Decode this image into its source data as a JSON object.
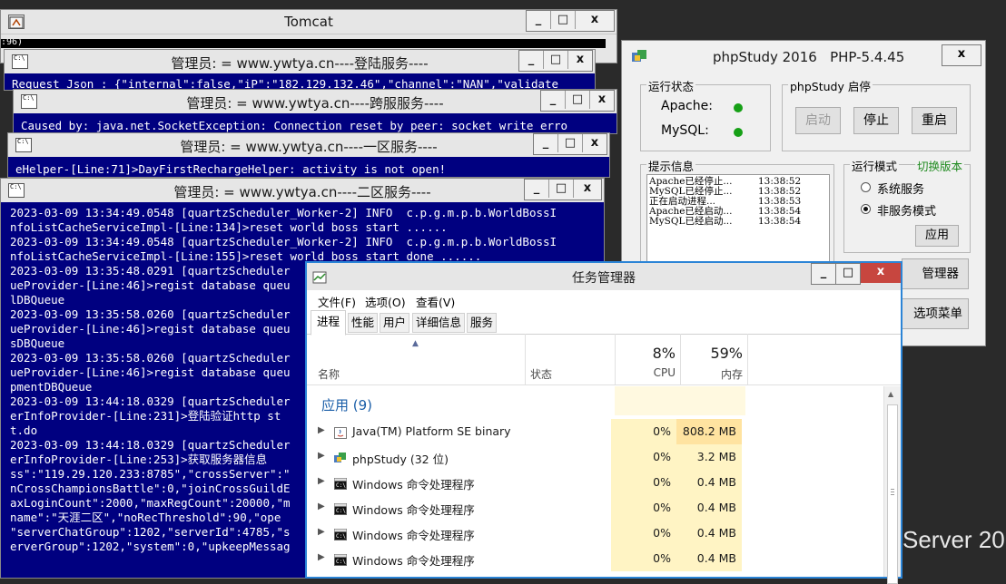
{
  "tomcat": {
    "title": "Tomcat",
    "line": ":96)"
  },
  "window_controls": {
    "minimize": "_",
    "maximize": "□",
    "close": "x"
  },
  "cmd_login": {
    "title": "管理员: = www.ywtya.cn----登陆服务----",
    "line": "Request Json : {\"internal\":false,\"iP\":\"182.129.132.46\",\"channel\":\"NAN\",\"validate"
  },
  "cmd_cross": {
    "title": "管理员: = www.ywtya.cn----跨服服务----",
    "line": "Caused by: java.net.SocketException: Connection reset by peer: socket write erro"
  },
  "cmd_zone1": {
    "title": "管理员: = www.ywtya.cn----一区服务----",
    "line": "eHelper-[Line:71]>DayFirstRechargeHelper: activity is not open!"
  },
  "cmd_zone2": {
    "title": "管理员: = www.ywtya.cn----二区服务----",
    "lines": [
      "2023-03-09 13:34:49.0548 [quartzScheduler_Worker-2] INFO  c.p.g.m.p.b.WorldBossI",
      "nfoListCacheServiceImpl-[Line:134]>reset world boss start ......",
      "2023-03-09 13:34:49.0548 [quartzScheduler_Worker-2] INFO  c.p.g.m.p.b.WorldBossI",
      "nfoListCacheServiceImpl-[Line:155]>reset world boss start done ......",
      "2023-03-09 13:35:48.0291 [quartzScheduler",
      "ueProvider-[Line:46]>regist database queu",
      "lDBQueue",
      "2023-03-09 13:35:58.0260 [quartzScheduler",
      "ueProvider-[Line:46]>regist database queu",
      "sDBQueue",
      "2023-03-09 13:35:58.0260 [quartzScheduler",
      "ueProvider-[Line:46]>regist database queu",
      "pmentDBQueue",
      "2023-03-09 13:44:18.0329 [quartzScheduler",
      "erInfoProvider-[Line:231]>登陆验证http st",
      "t.do",
      "2023-03-09 13:44:18.0329 [quartzScheduler",
      "erInfoProvider-[Line:253]>获取服务器信息",
      "ss\":\"119.29.120.233:8785\",\"crossServer\":\"",
      "nCrossChampionsBattle\":0,\"joinCrossGuildE",
      "axLoginCount\":2000,\"maxRegCount\":20000,\"m",
      "name\":\"天涯二区\",\"noRecThreshold\":90,\"ope",
      "\"serverChatGroup\":1202,\"serverId\":4785,\"s",
      "erverGroup\":1202,\"system\":0,\"upkeepMessag"
    ]
  },
  "phpstudy": {
    "title": "phpStudy 2016   PHP-5.4.45",
    "status_group": "运行状态",
    "apache_label": "Apache:",
    "mysql_label": "MySQL:",
    "start_group": "phpStudy 启停",
    "start_btn": "启动",
    "stop_btn": "停止",
    "restart_btn": "重启",
    "info_group": "提示信息",
    "logs": [
      {
        "msg": "Apache已经停止...",
        "time": "13:38:52"
      },
      {
        "msg": "MySQL已经停止...",
        "time": "13:38:52"
      },
      {
        "msg": "正在启动进程...",
        "time": "13:38:53"
      },
      {
        "msg": "Apache已经启动...",
        "time": "13:38:54"
      },
      {
        "msg": "MySQL已经启动...",
        "time": "13:38:54"
      }
    ],
    "mode_group": "运行模式",
    "switch_version": "切换版本",
    "system_service": "系统服务",
    "non_service": "非服务模式",
    "apply_btn": "应用",
    "manager_btn": "管理器",
    "options_btn": "选项菜单",
    "status_color": "#16a016"
  },
  "taskmgr": {
    "title": "任务管理器",
    "menu": [
      "文件(F)",
      "选项(O)",
      "查看(V)"
    ],
    "tabs": [
      "进程",
      "性能",
      "用户",
      "详细信息",
      "服务"
    ],
    "col_name": "名称",
    "col_status": "状态",
    "cpu_pct": "8%",
    "cpu_label": "CPU",
    "mem_pct": "59%",
    "mem_label": "内存",
    "group_label": "应用 (9)",
    "rows": [
      {
        "name": "Java(TM) Platform SE binary",
        "cpu": "0%",
        "mem": "808.2 MB"
      },
      {
        "name": "phpStudy (32 位)",
        "cpu": "0%",
        "mem": "3.2 MB"
      },
      {
        "name": "Windows 命令处理程序",
        "cpu": "0%",
        "mem": "0.4 MB"
      },
      {
        "name": "Windows 命令处理程序",
        "cpu": "0%",
        "mem": "0.4 MB"
      },
      {
        "name": "Windows 命令处理程序",
        "cpu": "0%",
        "mem": "0.4 MB"
      },
      {
        "name": "Windows 命令处理程序",
        "cpu": "0%",
        "mem": "0.4 MB"
      }
    ]
  },
  "desktop": {
    "watermark": "Server 20"
  }
}
